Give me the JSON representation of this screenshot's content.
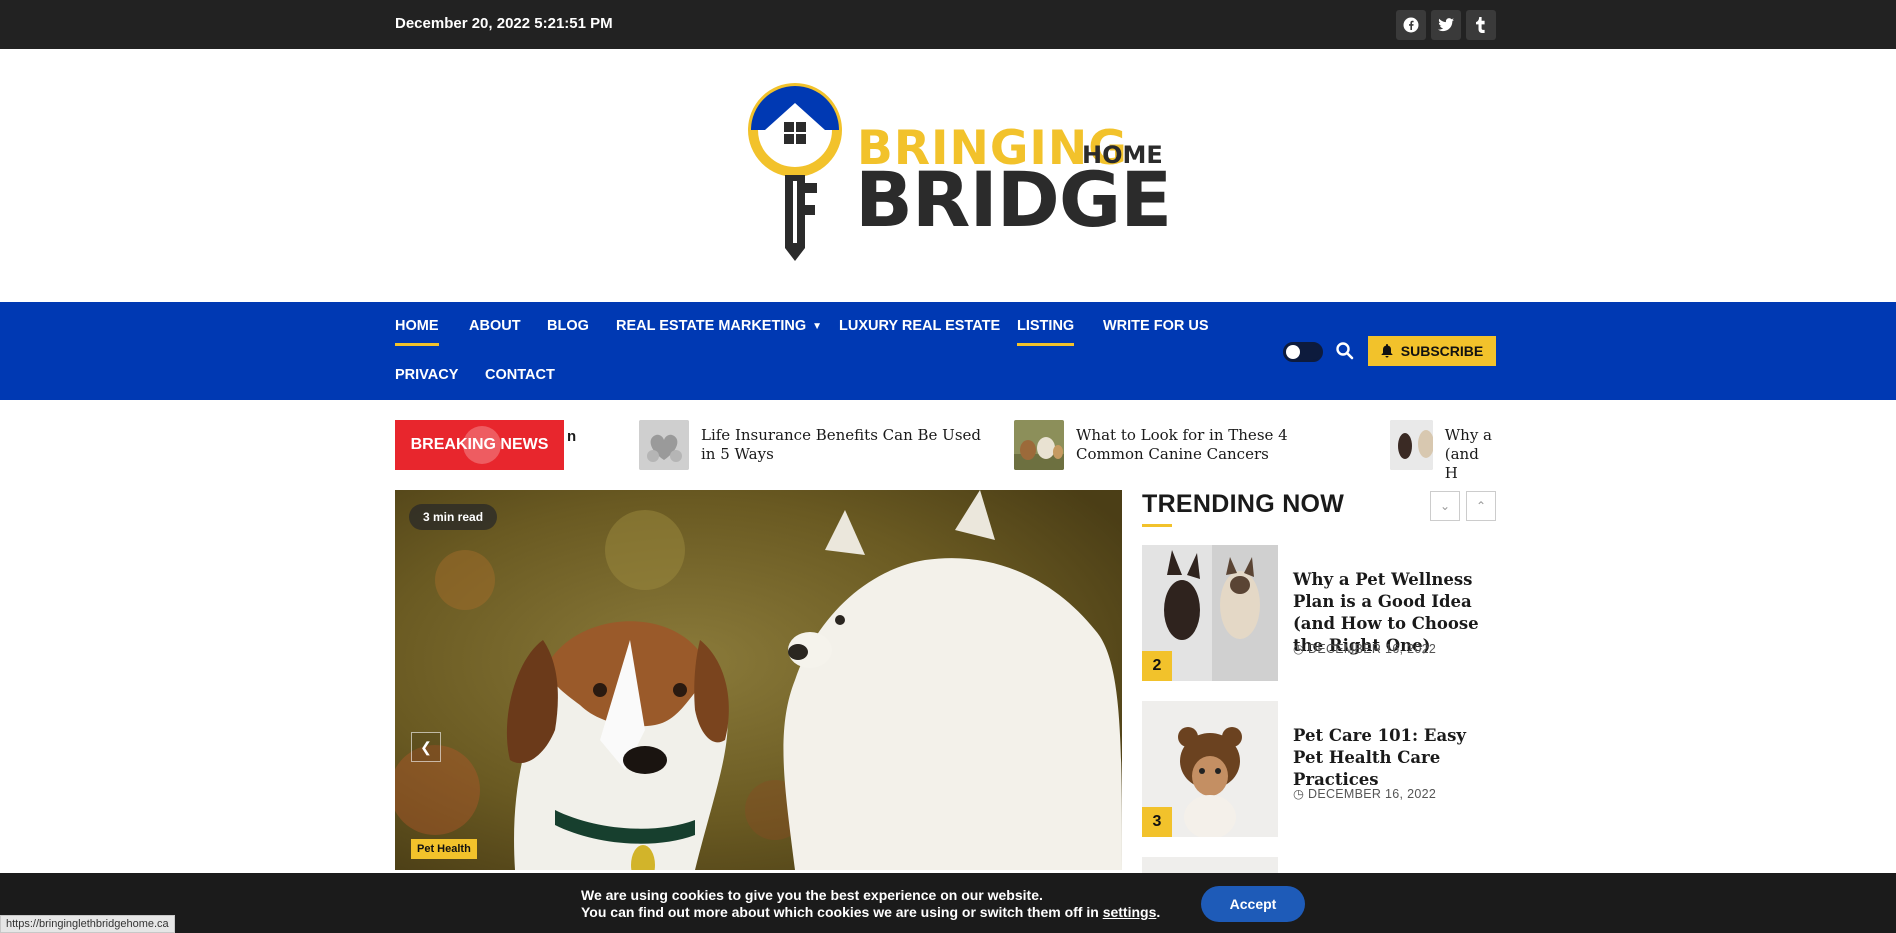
{
  "topbar": {
    "datetime": "December 20, 2022 5:21:51 PM",
    "social": [
      {
        "icon": "facebook-icon",
        "glyph": "f"
      },
      {
        "icon": "twitter-icon",
        "glyph": "t"
      },
      {
        "icon": "tumblr-icon",
        "glyph": "t"
      }
    ]
  },
  "logo": {
    "line1": "BRINGING",
    "line1_small": "HOME",
    "line2": "BRIDGE",
    "colors": {
      "yellow": "#f2c22b",
      "blue": "#0039b3",
      "dark": "#2b2b2b"
    }
  },
  "nav": {
    "items": [
      {
        "label": "HOME",
        "active": true
      },
      {
        "label": "ABOUT"
      },
      {
        "label": "BLOG"
      },
      {
        "label": "REAL ESTATE MARKETING",
        "dropdown": true
      },
      {
        "label": "LUXURY REAL ESTATE"
      },
      {
        "label": "LISTING",
        "active": true
      },
      {
        "label": "WRITE FOR US"
      },
      {
        "label": "PRIVACY"
      },
      {
        "label": "CONTACT"
      }
    ],
    "subscribe_label": "SUBSCRIBE"
  },
  "breaking": {
    "label": "BREAKING NEWS",
    "fragment": "n",
    "items": [
      {
        "title": "Life Insurance Benefits Can Be Used in 5 Ways"
      },
      {
        "title": "What to Look for in These 4 Common Canine Cancers"
      },
      {
        "title": "Why a (and H"
      }
    ]
  },
  "hero": {
    "read_time": "3 min read",
    "category": "Pet Health"
  },
  "trending": {
    "title": "TRENDING NOW",
    "items": [
      {
        "rank": "2",
        "title": "Why a Pet Wellness Plan is a Good Idea (and How to Choose the Right One)",
        "date": "DECEMBER 16, 2022"
      },
      {
        "rank": "3",
        "title": "Pet Care 101: Easy Pet Health Care Practices",
        "date": "DECEMBER 16, 2022"
      }
    ]
  },
  "cookie": {
    "line1": "We are using cookies to give you the best experience on our website.",
    "line2_prefix": "You can find out more about which cookies we are using or switch them off in ",
    "settings_link": "settings",
    "line2_suffix": ".",
    "accept_label": "Accept"
  },
  "status_url": "https://bringinglethbridgehome.ca"
}
